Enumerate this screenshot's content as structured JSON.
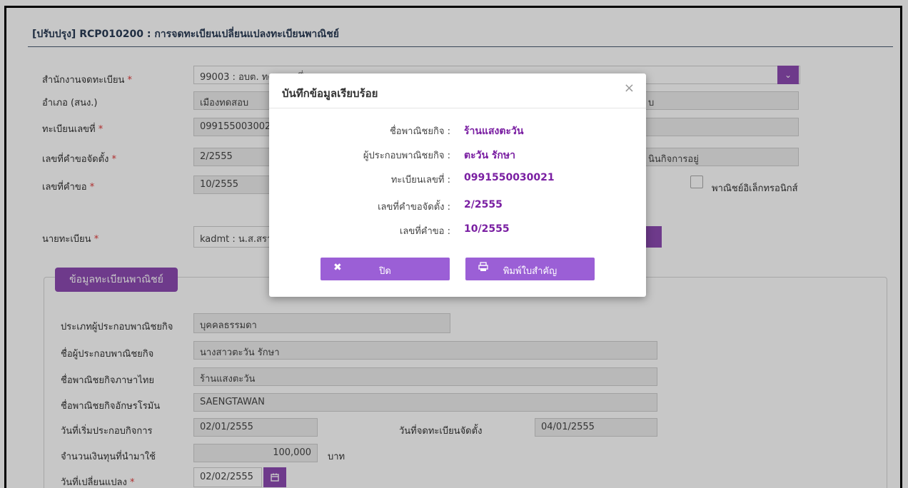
{
  "page": {
    "title": "[ปรับปรุง] RCP010200 : การจดทะเบียนเปลี่ยนแปลงทะเบียนพาณิชย์"
  },
  "form": {
    "office_label": "สำนักงานจดทะเบียน",
    "office_value": "99003 : อบต. ทดสอบหนึ่ง",
    "district_label": "อำเภอ (สนง.)",
    "district_value": "เมืองทดสอบ",
    "district_right_value": "บ",
    "reg_no_label": "ทะเบียนเลขที่",
    "reg_no_value": "0991550030021",
    "req_no_setup_label": "เลขที่คำขอจัดตั้ง",
    "req_no_setup_value": "2/2555",
    "status_right_value": "นินกิจการอยู่",
    "req_no_label": "เลขที่คำขอ",
    "req_no_value": "10/2555",
    "ecommerce_label": "พาณิชย์อิเล็กทรอนิกส์",
    "registrar_label": "นายทะเบียน",
    "registrar_value": "kadmt : น.ส.สรา",
    "required_mark": "*"
  },
  "section": {
    "tab_label": "ข้อมูลทะเบียนพาณิชย์",
    "operator_type_label": "ประเภทผู้ประกอบพาณิชยกิจ",
    "operator_type_value": "บุคคลธรรมดา",
    "operator_name_label": "ชื่อผู้ประกอบพาณิชยกิจ",
    "operator_name_value": "นางสาวตะวัน รักษา",
    "name_th_label": "ชื่อพาณิชยกิจภาษาไทย",
    "name_th_value": "ร้านแสงตะวัน",
    "name_en_label": "ชื่อพาณิชยกิจอักษรโรมัน",
    "name_en_value": "SAENGTAWAN",
    "start_date_label": "วันที่เริ่มประกอบกิจการ",
    "start_date_value": "02/01/2555",
    "setup_date_label": "วันที่จดทะเบียนจัดตั้ง",
    "setup_date_value": "04/01/2555",
    "capital_label": "จำนวนเงินทุนที่นำมาใช้",
    "capital_value": "100,000",
    "capital_unit": "บาท",
    "change_date_label": "วันที่เปลี่ยนแปลง",
    "change_date_value": "02/02/2555"
  },
  "modal": {
    "title": "บันทึกข้อมูลเรียบร้อย",
    "close_glyph": "×",
    "rows": [
      {
        "label": "ชื่อพาณิชยกิจ :",
        "value": "ร้านแสงตะวัน"
      },
      {
        "label": "ผู้ประกอบพาณิชยกิจ :",
        "value": "ตะวัน รักษา"
      },
      {
        "label": "ทะเบียนเลขที่ :",
        "value": "0991550030021"
      },
      {
        "label": "เลขที่คำขอจัดตั้ง :",
        "value": "2/2555"
      },
      {
        "label": "เลขที่คำขอ :",
        "value": "10/2555"
      }
    ],
    "close_button": "ปิด",
    "print_button": "พิมพ์ใบสำคัญ"
  },
  "colors": {
    "accent": "#8e4bb3",
    "modal_button": "#9b5fd6",
    "value_text": "#7a1fa2",
    "required": "#e03a3a"
  }
}
